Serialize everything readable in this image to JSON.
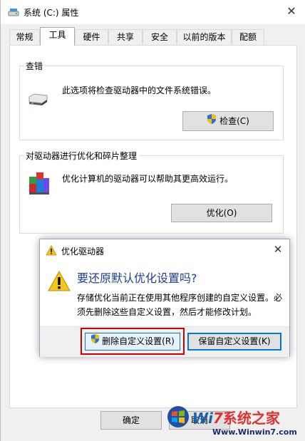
{
  "window": {
    "title": "系统 (C:) 属性",
    "close_glyph": "✕"
  },
  "tabs": [
    {
      "label": "常规"
    },
    {
      "label": "工具",
      "selected": true
    },
    {
      "label": "硬件"
    },
    {
      "label": "共享"
    },
    {
      "label": "安全"
    },
    {
      "label": "以前的版本"
    },
    {
      "label": "配额"
    }
  ],
  "error_check": {
    "group_title": "查错",
    "description": "此选项将检查驱动器中的文件系统错误。",
    "button_label": "检查(C)"
  },
  "optimize": {
    "group_title": "对驱动器进行优化和碎片整理",
    "description": "优化计算机的驱动器可以帮助其更高效运行。",
    "button_label": "优化(O)"
  },
  "dialog": {
    "title": "优化驱动器",
    "question": "要还原默认优化设置吗?",
    "description": "存储优化当前正在使用其他程序创建的自定义设置。必须先删除这些自定义设置，然后才能修改计划。",
    "delete_button": "删除自定义设置(R)",
    "keep_button": "保留自定义设置(K)",
    "close_glyph": "✕"
  },
  "footer": {
    "ok_label": "确定",
    "cancel_label": "取消"
  },
  "watermark": {
    "logo_text": "系统之家",
    "logo_prefix": "Wi",
    "logo_suffix": "7",
    "url": "Www.Winwin7.com"
  },
  "colors": {
    "accent": "#0078d7",
    "highlight": "#d10000",
    "question_blue": "#1c3f95"
  },
  "icons": [
    "drive-icon",
    "shield-icon",
    "defrag-icon",
    "warning-icon",
    "close-icon",
    "windows-logo-icon"
  ]
}
